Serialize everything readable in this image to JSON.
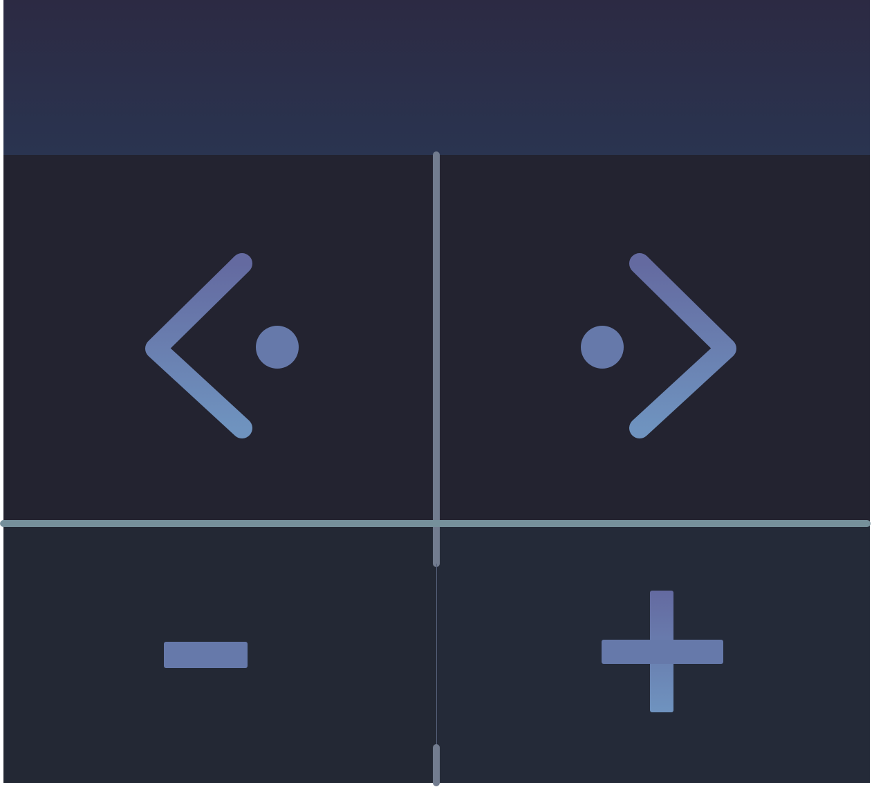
{
  "controls": {
    "prev": {
      "icon": "chevron-left-dot-icon"
    },
    "next": {
      "icon": "chevron-right-dot-icon"
    },
    "minus": {
      "icon": "minus-icon"
    },
    "plus": {
      "icon": "plus-icon"
    }
  },
  "colors": {
    "icon_top": "#646aa0",
    "icon_bottom": "#6f93bf",
    "background": "#232330",
    "header": "#2b3049",
    "divider": "#76909b"
  }
}
